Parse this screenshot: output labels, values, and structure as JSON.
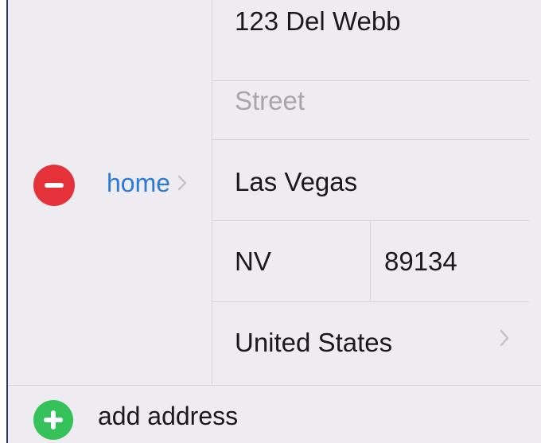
{
  "address": {
    "label": "home",
    "street_line1": "123 Del Webb",
    "street_line2_placeholder": "Street",
    "city": "Las Vegas",
    "state": "NV",
    "zip": "89134",
    "country": "United States"
  },
  "actions": {
    "add_address_label": "add address"
  },
  "icons": {
    "remove": "minus-circle-icon",
    "add": "plus-circle-icon",
    "disclosure": "chevron-right-icon"
  },
  "colors": {
    "remove_red": "#e5323a",
    "add_green": "#35c25a",
    "label_blue": "#2a7ad8",
    "background": "#efecf1",
    "placeholder_gray": "#a7a6ab"
  }
}
